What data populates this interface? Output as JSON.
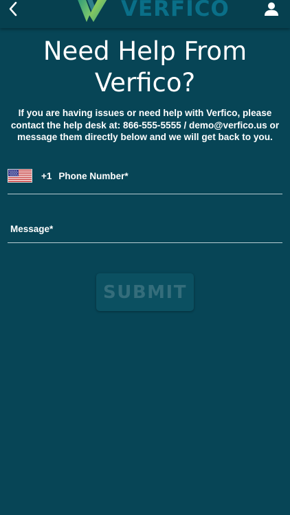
{
  "header": {
    "back_icon": "chevron-left-icon",
    "logo_text": "VERFICO",
    "profile_icon": "user-icon"
  },
  "page": {
    "title": "Need Help From Verfico?",
    "info": "If you are having issues or need help with Verfico, please contact the help desk at: 866-555-5555 / demo@verfico.us or message them directly below and we will get back to you."
  },
  "form": {
    "country_flag": "us-flag-icon",
    "country_code": "+1",
    "phone_placeholder": "Phone Number*",
    "phone_value": "",
    "message_placeholder": "Message*",
    "message_value": "",
    "submit_label": "SUBMIT"
  },
  "colors": {
    "background": "#074556",
    "header": "#06404f",
    "logo_text": "#0a6f88",
    "submit_bg": "#0b5061",
    "submit_text": "#346d7b"
  }
}
